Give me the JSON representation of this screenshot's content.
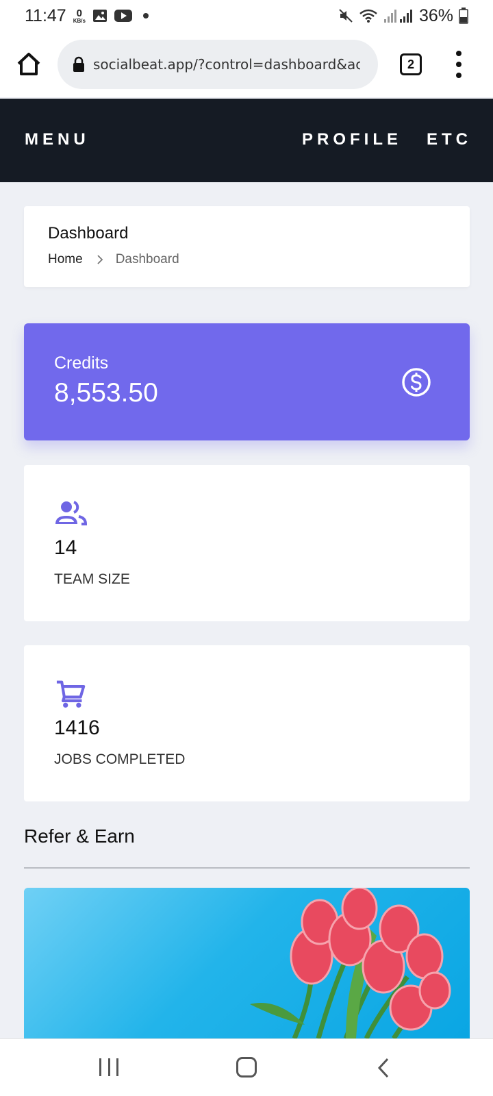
{
  "status_bar": {
    "time": "11:47",
    "data_rate_value": "0",
    "data_rate_unit": "KB/s",
    "battery": "36%",
    "icons": [
      "image-icon",
      "youtube-icon",
      "mute-icon",
      "wifi-icon",
      "signal-icon",
      "battery-icon"
    ]
  },
  "browser": {
    "url": "socialbeat.app/?control=dashboard&acti",
    "tab_count": "2"
  },
  "nav": {
    "menu": "MENU",
    "profile": "PROFILE",
    "etc": "ETC"
  },
  "breadcrumb": {
    "title": "Dashboard",
    "home": "Home",
    "current": "Dashboard"
  },
  "credits": {
    "label": "Credits",
    "value": "8,553.50",
    "icon": "dollar-circle-icon",
    "color": "#7169ec"
  },
  "stats": [
    {
      "value": "14",
      "label": "TEAM SIZE",
      "icon": "team-icon"
    },
    {
      "value": "1416",
      "label": "JOBS COMPLETED",
      "icon": "cart-icon"
    }
  ],
  "refer": {
    "title": "Refer & Earn"
  },
  "colors": {
    "nav_bg": "#151b24",
    "accent": "#7169ec",
    "page_bg": "#eef0f5"
  }
}
